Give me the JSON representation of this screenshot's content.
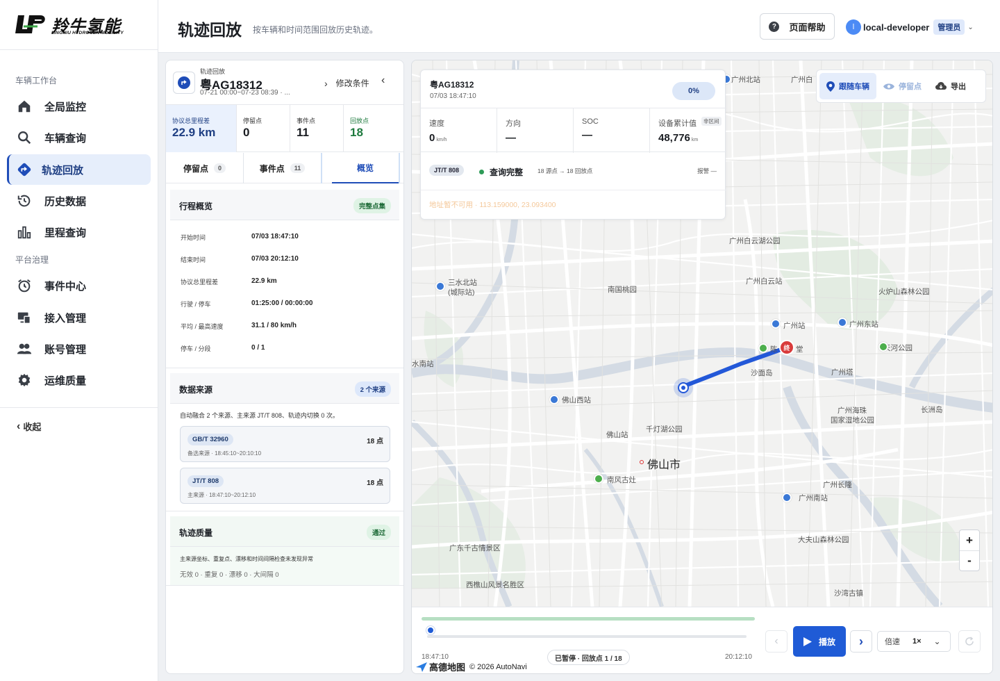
{
  "sidebar": {
    "logo_cn": "羚牛氢能",
    "logo_en": "LINGNIU HYDROGEN MOBILITY",
    "groups": [
      {
        "label": "车辆工作台"
      },
      {
        "label": "平台治理"
      }
    ],
    "items": [
      {
        "label": "全局监控",
        "icon": "home-icon"
      },
      {
        "label": "车辆查询",
        "icon": "search-icon"
      },
      {
        "label": "轨迹回放",
        "icon": "route-icon",
        "active": true
      },
      {
        "label": "历史数据",
        "icon": "history-icon"
      },
      {
        "label": "里程查询",
        "icon": "bar-chart-icon"
      },
      {
        "label": "事件中心",
        "icon": "alarm-clock-icon"
      },
      {
        "label": "接入管理",
        "icon": "devices-icon"
      },
      {
        "label": "账号管理",
        "icon": "users-icon"
      },
      {
        "label": "运维质量",
        "icon": "gear-icon"
      }
    ],
    "collapse_label": "收起"
  },
  "header": {
    "title": "轨迹回放",
    "subtitle": "按车辆和时间范围回放历史轨迹。",
    "help_label": "页面帮助",
    "user_initial": "l",
    "user_name": "local-developer",
    "user_role": "管理员"
  },
  "panel": {
    "caption": "轨迹回放",
    "plate": "粤AG18312",
    "range": "07-21 00:00~07-23 08:39 · ...",
    "modify_label": "修改条件",
    "stats": [
      {
        "label": "协议总里程差",
        "value": "22.9 km"
      },
      {
        "label": "停留点",
        "value": "0"
      },
      {
        "label": "事件点",
        "value": "11"
      },
      {
        "label": "回放点",
        "value": "18"
      }
    ],
    "tabs": [
      {
        "label": "停留点",
        "count": "0"
      },
      {
        "label": "事件点",
        "count": "11"
      },
      {
        "label": "概览"
      }
    ],
    "overview": {
      "title": "行程概览",
      "badge": "完整点集",
      "rows": [
        {
          "k": "开始时间",
          "v": "07/03 18:47:10"
        },
        {
          "k": "结束时间",
          "v": "07/03 20:12:10"
        },
        {
          "k": "协议总里程差",
          "v": "22.9 km"
        },
        {
          "k": "行驶 / 停车",
          "v": "01:25:00 / 00:00:00"
        },
        {
          "k": "平均 / 最高速度",
          "v": "31.1 / 80 km/h"
        },
        {
          "k": "停车 / 分段",
          "v": "0 / 1"
        }
      ]
    },
    "sources": {
      "title": "数据来源",
      "badge": "2 个来源",
      "note": "自动融合 2 个来源、主来源 JT/T 808、轨迹内切换 0 次。",
      "items": [
        {
          "tag": "GB/T 32960",
          "points": "18 点",
          "desc": "备选来源 · 18:45:10~20:10:10"
        },
        {
          "tag": "JT/T 808",
          "points": "18 点",
          "desc": "主来源 · 18:47:10~20:12:10"
        }
      ]
    },
    "quality": {
      "title": "轨迹质量",
      "badge": "通过",
      "note": "主来源坐标、重复点、漂移和时间间隔检查未发现异常",
      "summary": "无效 0 · 重复 0 · 漂移 0 · 大间隔 0"
    }
  },
  "map": {
    "info": {
      "plate": "粤AG18312",
      "time": "07/03 18:47:10",
      "progress": "0%",
      "metrics": [
        {
          "label": "速度",
          "value": "0",
          "unit": "km/h"
        },
        {
          "label": "方向",
          "value": "—",
          "unit": ""
        },
        {
          "label": "SOC",
          "value": "—",
          "unit": ""
        },
        {
          "label": "设备累计值",
          "value": "48,776",
          "unit": "km",
          "tag": "非区间"
        }
      ],
      "protocol": "JT/T 808",
      "status": "查询完整",
      "meta": "18 源点 → 18 回放点",
      "alarm": "报警 —",
      "address": "地址暂不可用 · 113.159000, 23.093400"
    },
    "tools": {
      "follow": "跟随车辆",
      "stops": "停留点",
      "export": "导出"
    },
    "labels": [
      {
        "text": "广州北站"
      },
      {
        "text": "广州白云湖公园"
      },
      {
        "text": "广州白云站"
      },
      {
        "text": "三水北站"
      },
      {
        "text": "(城际站)"
      },
      {
        "text": "南国桃园"
      },
      {
        "text": "火炉山森林公园"
      },
      {
        "text": "广州站"
      },
      {
        "text": "广州东站"
      },
      {
        "text": "天河公园"
      },
      {
        "text": "陈"
      },
      {
        "text": "堂"
      },
      {
        "text": "沙面岛"
      },
      {
        "text": "广州塔"
      },
      {
        "text": "水南站"
      },
      {
        "text": "佛山西站"
      },
      {
        "text": "广州海珠"
      },
      {
        "text": "国家湿地公园"
      },
      {
        "text": "长洲岛"
      },
      {
        "text": "千灯湖公园"
      },
      {
        "text": "佛山站"
      },
      {
        "text": "佛山市"
      },
      {
        "text": "南风古灶"
      },
      {
        "text": "广州长隆"
      },
      {
        "text": "广州南站"
      },
      {
        "text": "大夫山森林公园"
      },
      {
        "text": "广东千古情景区"
      },
      {
        "text": "西樵山风景名胜区"
      },
      {
        "text": "沙湾古镇"
      },
      {
        "text": "广州白"
      }
    ],
    "zoom_in": "+",
    "zoom_out": "-",
    "end_marker": "终",
    "player": {
      "start_time": "18:47:10",
      "end_time": "20:12:10",
      "status": "已暂停 · 回放点 1 / 18",
      "play_label": "播放",
      "speed_label": "倍速",
      "speed_value": "1×",
      "progress": 0
    },
    "attribution": {
      "brand": "高德地图",
      "copy": "© 2026 AutoNavi"
    }
  },
  "colors": {
    "accent": "#1f4db8",
    "play": "#1f5bd6",
    "route": "#2358d8",
    "good": "#1e7a3e"
  }
}
